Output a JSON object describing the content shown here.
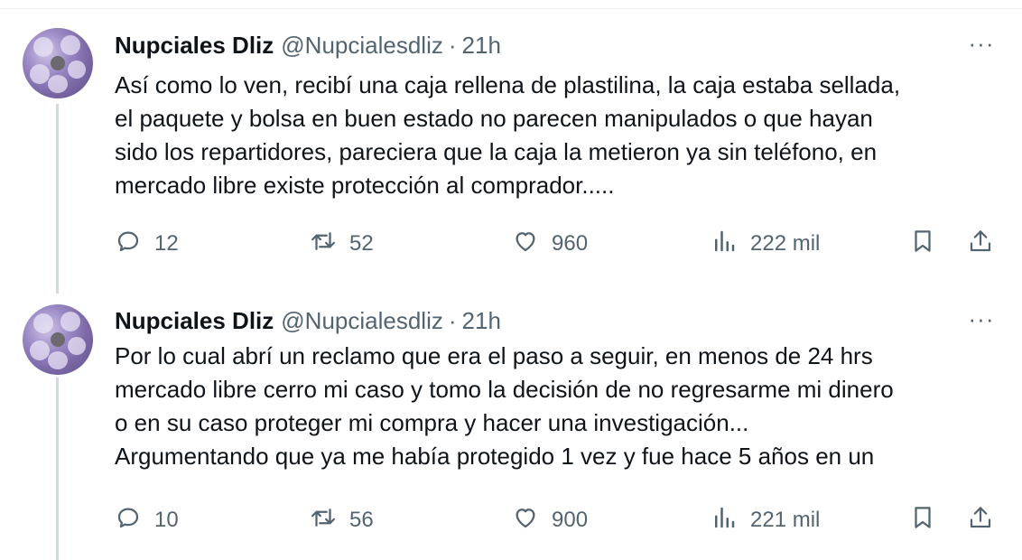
{
  "tweets": [
    {
      "display_name": "Nupciales Dliz",
      "handle": "@Nupcialesdliz",
      "separator": "·",
      "time": "21h",
      "more_label": "···",
      "text_lines": [
        "Así como lo ven, recibí una caja rellena de plastilina, la caja estaba sellada,",
        "el paquete y bolsa en buen estado no parecen manipulados o que hayan",
        "sido los repartidores, pareciera que la caja la metieron ya sin teléfono, en",
        "mercado libre existe protección al comprador....."
      ],
      "replies": "12",
      "reposts": "52",
      "likes": "960",
      "views": "222 mil"
    },
    {
      "display_name": "Nupciales Dliz",
      "handle": "@Nupcialesdliz",
      "separator": "·",
      "time": "21h",
      "more_label": "···",
      "text_lines": [
        "Por lo cual abrí un reclamo que era el paso a seguir, en menos de 24 hrs",
        "mercado libre cerro mi caso y tomo la decisión de no regresarme mi dinero",
        "o en su caso proteger mi compra y hacer una investigación...",
        "Argumentando que ya me había protegido 1 vez y fue hace 5 años en un"
      ],
      "replies": "10",
      "reposts": "56",
      "likes": "900",
      "views": "221 mil"
    }
  ],
  "icons": {
    "reply": "reply-icon",
    "repost": "repost-icon",
    "like": "heart-icon",
    "views": "views-chart-icon",
    "bookmark": "bookmark-icon",
    "share": "share-icon"
  },
  "colors": {
    "text_primary": "#0f1419",
    "text_secondary": "#536471",
    "thread_line": "#cfd9de"
  }
}
